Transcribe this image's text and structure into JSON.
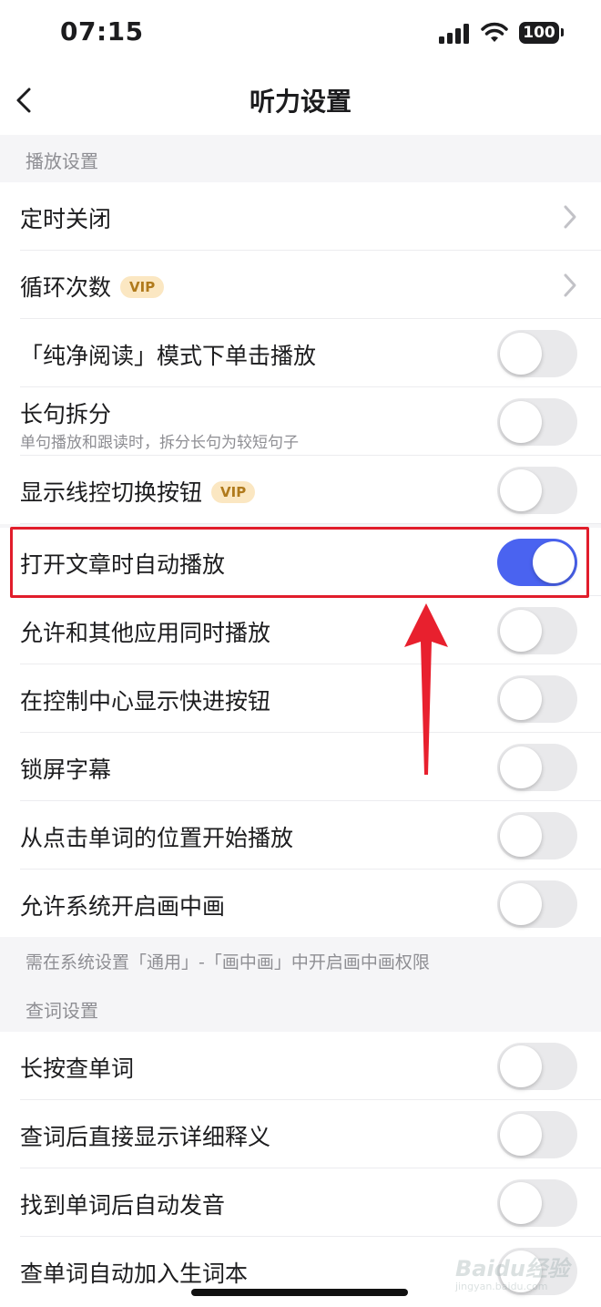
{
  "status_bar": {
    "time": "07:15",
    "battery": "100"
  },
  "nav": {
    "title": "听力设置"
  },
  "sections": {
    "playback": {
      "header": "播放设置"
    },
    "lookup": {
      "header": "查词设置"
    }
  },
  "rows": {
    "timer_off": {
      "label": "定时关闭"
    },
    "loop_count": {
      "label": "循环次数",
      "badge": "VIP"
    },
    "pure_read_tap": {
      "label": "「纯净阅读」模式下单击播放",
      "enabled": false
    },
    "split_long": {
      "label": "长句拆分",
      "sublabel": "单句播放和跟读时，拆分长句为较短句子",
      "enabled": false
    },
    "wire_control": {
      "label": "显示线控切换按钮",
      "badge": "VIP",
      "enabled": false
    },
    "auto_play": {
      "label": "打开文章时自动播放",
      "enabled": true
    },
    "mix_others": {
      "label": "允许和其他应用同时播放",
      "enabled": false
    },
    "fast_forward": {
      "label": "在控制中心显示快进按钮",
      "enabled": false
    },
    "lock_subtitles": {
      "label": "锁屏字幕",
      "enabled": false
    },
    "play_from_word": {
      "label": "从点击单词的位置开始播放",
      "enabled": false
    },
    "pip": {
      "label": "允许系统开启画中画",
      "enabled": false
    },
    "long_press_lookup": {
      "label": "长按查单词",
      "enabled": false
    },
    "show_details": {
      "label": "查词后直接显示详细释义",
      "enabled": false
    },
    "auto_pronounce": {
      "label": "找到单词后自动发音",
      "enabled": false
    },
    "add_to_wordbook": {
      "label": "查单词自动加入生词本",
      "enabled": false
    }
  },
  "pip_note": "需在系统设置「通用」-「画中画」中开启画中画权限",
  "watermark": {
    "brand": "Baidu经验",
    "url": "jingyan.baidu.com"
  },
  "colors": {
    "toggle_on": "#4a63f0",
    "highlight": "#e11d2b",
    "vip_bg": "#fbe7c2"
  }
}
